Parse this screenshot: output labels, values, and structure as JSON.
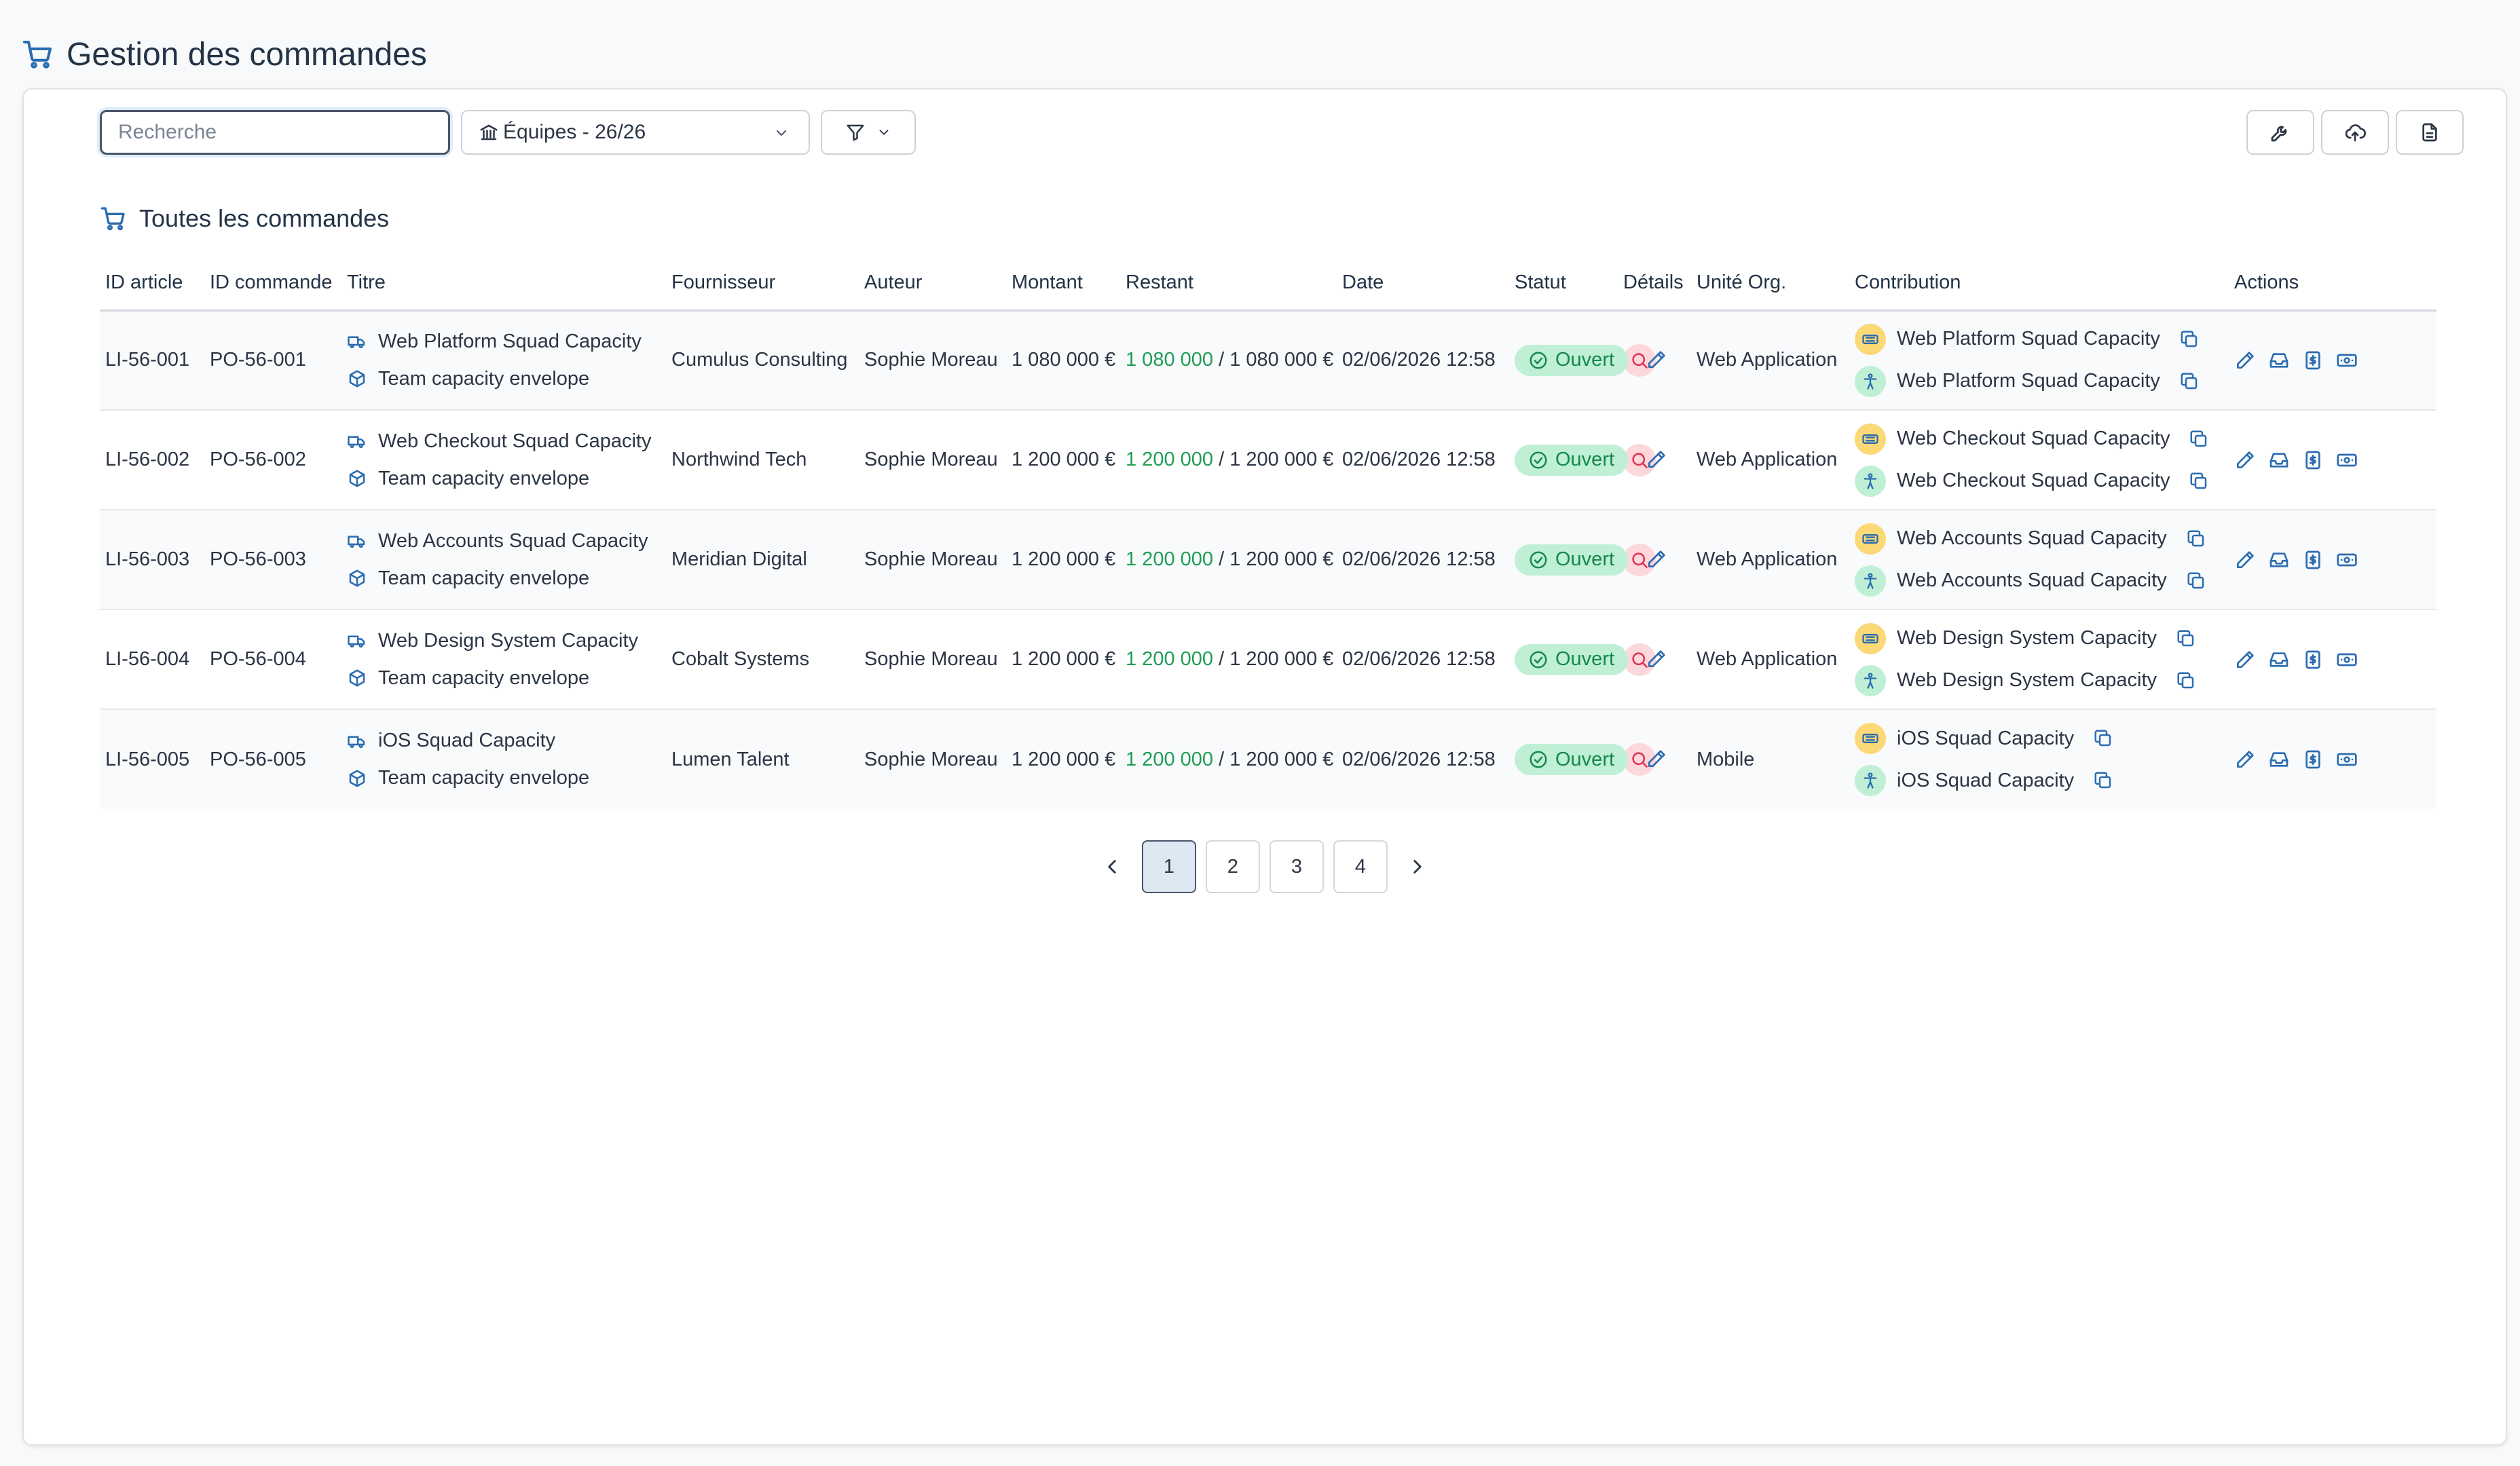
{
  "page": {
    "title": "Gestion des commandes"
  },
  "toolbar": {
    "search_placeholder": "Recherche",
    "search_value": "",
    "teams_label": "Équipes - 26/26"
  },
  "section": {
    "title": "Toutes les commandes"
  },
  "table": {
    "columns": [
      "ID article",
      "ID commande",
      "Titre",
      "Fournisseur",
      "Auteur",
      "Montant",
      "Restant",
      "Date",
      "Statut",
      "Détails",
      "Unité Org.",
      "Contribution",
      "Actions"
    ],
    "rows": [
      {
        "article_id": "LI-56-001",
        "order_id": "PO-56-001",
        "title": "Web Platform Squad Capacity",
        "subtitle": "Team capacity envelope",
        "supplier": "Cumulus Consulting",
        "author": "Sophie Moreau",
        "amount": "1 080 000 €",
        "remaining": "1 080 000",
        "remaining_total": "/ 1 080 000 €",
        "date": "02/06/2026 12:58",
        "status": "Ouvert",
        "org_unit": "Web Application",
        "contribution_1": "Web Platform Squad Capacity",
        "contribution_2": "Web Platform Squad Capacity"
      },
      {
        "article_id": "LI-56-002",
        "order_id": "PO-56-002",
        "title": "Web Checkout Squad Capacity",
        "subtitle": "Team capacity envelope",
        "supplier": "Northwind Tech",
        "author": "Sophie Moreau",
        "amount": "1 200 000 €",
        "remaining": "1 200 000",
        "remaining_total": "/ 1 200 000 €",
        "date": "02/06/2026 12:58",
        "status": "Ouvert",
        "org_unit": "Web Application",
        "contribution_1": "Web Checkout Squad Capacity",
        "contribution_2": "Web Checkout Squad Capacity"
      },
      {
        "article_id": "LI-56-003",
        "order_id": "PO-56-003",
        "title": "Web Accounts Squad Capacity",
        "subtitle": "Team capacity envelope",
        "supplier": "Meridian Digital",
        "author": "Sophie Moreau",
        "amount": "1 200 000 €",
        "remaining": "1 200 000",
        "remaining_total": "/ 1 200 000 €",
        "date": "02/06/2026 12:58",
        "status": "Ouvert",
        "org_unit": "Web Application",
        "contribution_1": "Web Accounts Squad Capacity",
        "contribution_2": "Web Accounts Squad Capacity"
      },
      {
        "article_id": "LI-56-004",
        "order_id": "PO-56-004",
        "title": "Web Design System Capacity",
        "subtitle": "Team capacity envelope",
        "supplier": "Cobalt Systems",
        "author": "Sophie Moreau",
        "amount": "1 200 000 €",
        "remaining": "1 200 000",
        "remaining_total": "/ 1 200 000 €",
        "date": "02/06/2026 12:58",
        "status": "Ouvert",
        "org_unit": "Web Application",
        "contribution_1": "Web Design System Capacity",
        "contribution_2": "Web Design System Capacity"
      },
      {
        "article_id": "LI-56-005",
        "order_id": "PO-56-005",
        "title": "iOS Squad Capacity",
        "subtitle": "Team capacity envelope",
        "supplier": "Lumen Talent",
        "author": "Sophie Moreau",
        "amount": "1 200 000 €",
        "remaining": "1 200 000",
        "remaining_total": "/ 1 200 000 €",
        "date": "02/06/2026 12:58",
        "status": "Ouvert",
        "org_unit": "Mobile",
        "contribution_1": "iOS Squad Capacity",
        "contribution_2": "iOS Squad Capacity"
      }
    ]
  },
  "pagination": {
    "pages": [
      "1",
      "2",
      "3",
      "4"
    ],
    "current": "1"
  },
  "colors": {
    "accent": "#2b6cb0",
    "status_bg": "#bff0d5",
    "status_text": "#15884a",
    "remaining": "#1f9d55",
    "detail_bg": "#fcd7dc",
    "detail_icon": "#e0314e",
    "contrib_yellow": "#fbd977"
  }
}
